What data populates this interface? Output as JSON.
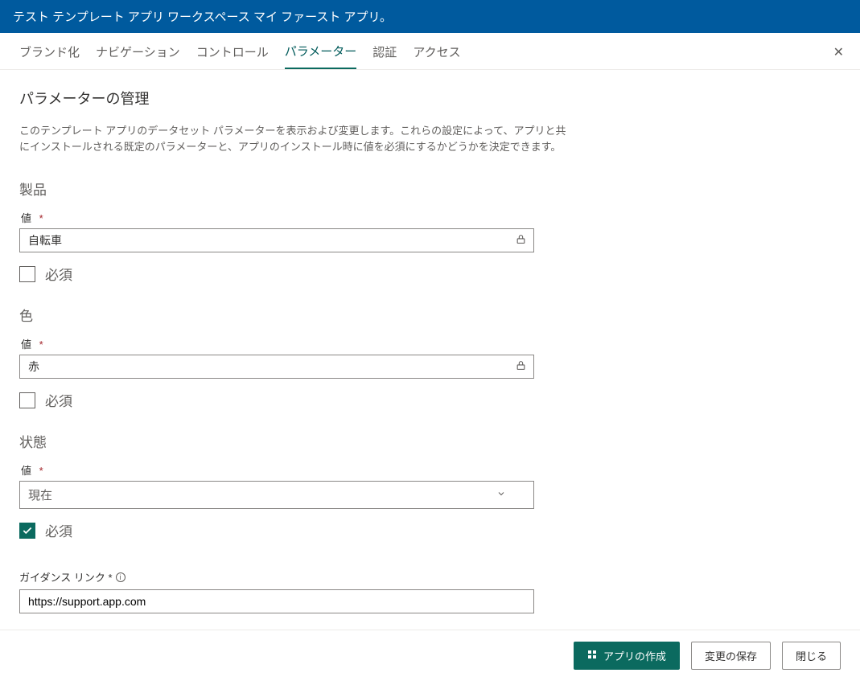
{
  "header": {
    "title": "テスト テンプレート アプリ ワークスペース マイ ファースト アプリ。"
  },
  "tabs": {
    "items": [
      {
        "label": "ブランド化"
      },
      {
        "label": "ナビゲーション"
      },
      {
        "label": "コントロール"
      },
      {
        "label": "パラメーター"
      },
      {
        "label": "認証"
      },
      {
        "label": "アクセス"
      }
    ],
    "active_index": 3
  },
  "page": {
    "title": "パラメーターの管理",
    "description": "このテンプレート アプリのデータセット パラメーターを表示および変更します。これらの設定によって、アプリと共にインストールされる既定のパラメーターと、アプリのインストール時に値を必須にするかどうかを決定できます。"
  },
  "params": [
    {
      "name": "製品",
      "value_label": "値",
      "value": "自転車",
      "locked": true,
      "required_label": "必須",
      "required_checked": false,
      "type": "text"
    },
    {
      "name": "色",
      "value_label": "値",
      "value": "赤",
      "locked": true,
      "required_label": "必須",
      "required_checked": false,
      "type": "text"
    },
    {
      "name": "状態",
      "value_label": "値",
      "value": "現在",
      "locked": false,
      "required_label": "必須",
      "required_checked": true,
      "type": "select"
    }
  ],
  "guidance": {
    "label": "ガイダンス リンク *",
    "value": "https://support.app.com"
  },
  "footer": {
    "create": "アプリの作成",
    "save": "変更の保存",
    "close": "閉じる"
  },
  "strings": {
    "required_star": "*"
  }
}
